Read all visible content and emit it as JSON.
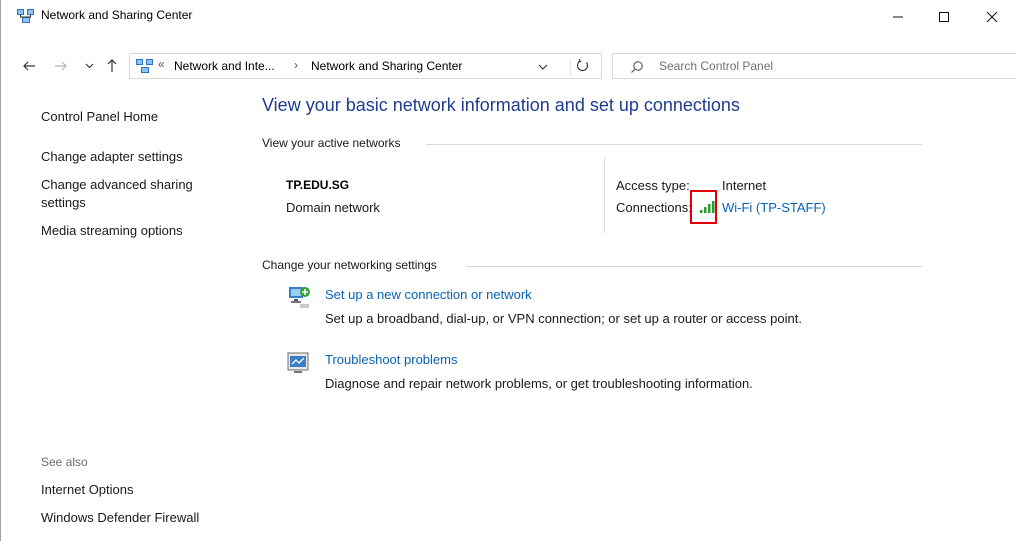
{
  "window": {
    "title": "Network and Sharing Center"
  },
  "address_bar": {
    "overflow_chevron": "«",
    "crumb_separator": "›",
    "crumbs": [
      "Network and Inte...",
      "Network and Sharing Center"
    ]
  },
  "search": {
    "placeholder": "Search Control Panel"
  },
  "sidebar": {
    "links": [
      "Control Panel Home",
      "Change adapter settings",
      "Change advanced sharing",
      "settings",
      "Media streaming options"
    ],
    "see_also_heading": "See also",
    "see_also_links": [
      "Internet Options",
      "Windows Defender Firewall"
    ]
  },
  "main": {
    "title": "View your basic network information and set up connections",
    "active_networks_heading": "View your active networks",
    "network": {
      "name": "TP.EDU.SG",
      "category": "Domain network",
      "access_type_label": "Access type:",
      "access_type_value": "Internet",
      "connections_label": "Connections:",
      "connection_name": "Wi-Fi (TP-STAFF)"
    },
    "settings_heading": "Change your networking settings",
    "tasks": [
      {
        "link": "Set up a new connection or network",
        "description": "Set up a broadband, dial-up, or VPN connection; or set up a router or access point."
      },
      {
        "link": "Troubleshoot problems",
        "description": "Diagnose and repair network problems, or get troubleshooting information."
      }
    ]
  },
  "colors": {
    "title_blue": "#1e3d8f",
    "link_blue": "#0a62b5",
    "highlight_red": "#e00000",
    "signal_green": "#2e9b2e"
  },
  "icons": {
    "app": "network-sharing-icon",
    "wifi": "wifi-signal-icon",
    "new_connection": "new-connection-icon",
    "troubleshoot": "troubleshoot-icon"
  }
}
